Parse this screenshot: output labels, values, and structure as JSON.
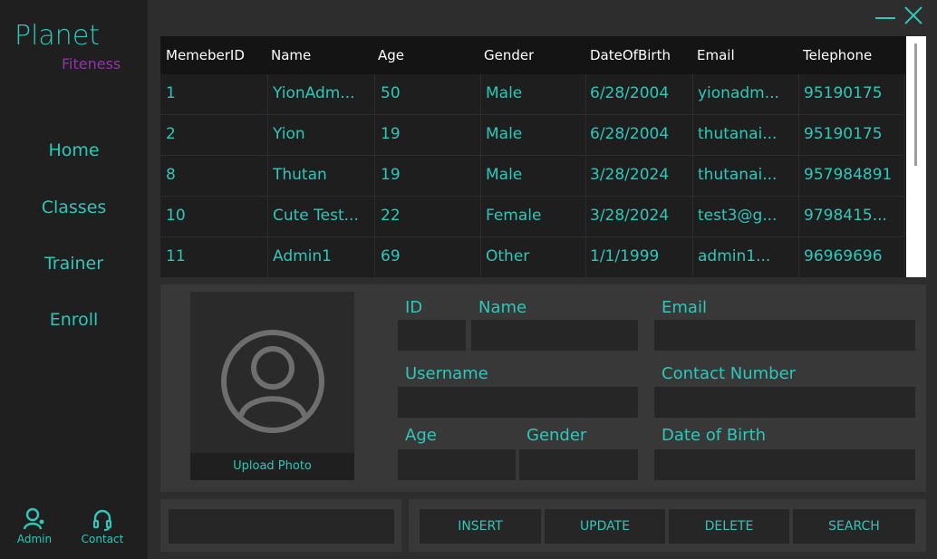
{
  "brand": {
    "title": "Planet",
    "subtitle": "Fiteness"
  },
  "nav": {
    "items": [
      {
        "label": "Home"
      },
      {
        "label": "Classes"
      },
      {
        "label": "Trainer"
      },
      {
        "label": "Enroll"
      }
    ],
    "bottom": [
      {
        "label": "Admin",
        "icon": "admin-user-icon"
      },
      {
        "label": "Contact",
        "icon": "headset-icon"
      }
    ]
  },
  "window": {
    "minimize_icon": "minimize-icon",
    "close_icon": "close-icon"
  },
  "table": {
    "columns": [
      "MemeberID",
      "Name",
      "Age",
      "Gender",
      "DateOfBirth",
      "Email",
      "Telephone"
    ],
    "rows": [
      [
        "1",
        "YionAdm...",
        "50",
        "Male",
        "6/28/2004",
        "yionadm...",
        "95190175"
      ],
      [
        "2",
        "Yion",
        "19",
        "Male",
        "6/28/2004",
        "thutanai...",
        "95190175"
      ],
      [
        "8",
        "Thutan",
        "19",
        "Male",
        "3/28/2024",
        "thutanai...",
        "957984891"
      ],
      [
        "10",
        "Cute Test...",
        "22",
        "Female",
        "3/28/2024",
        "test3@g...",
        "9798415..."
      ],
      [
        "11",
        "Admin1",
        "69",
        "Other",
        "1/1/1999",
        "admin1...",
        "96969696"
      ]
    ]
  },
  "form": {
    "upload_label": "Upload Photo",
    "labels": {
      "id": "ID",
      "name": "Name",
      "email": "Email",
      "username": "Username",
      "contact": "Contact Number",
      "age": "Age",
      "gender": "Gender",
      "dob": "Date of Birth"
    },
    "values": {
      "id": "",
      "name": "",
      "email": "",
      "username": "",
      "contact": "",
      "age": "",
      "gender": "",
      "dob": ""
    }
  },
  "actions": {
    "search_value": "",
    "insert": "INSERT",
    "update": "UPDATE",
    "delete": "DELETE",
    "search": "SEARCH"
  },
  "colors": {
    "accent": "#2fc7b9",
    "brand_sub": "#9a2fb3",
    "sidebar": "#1f1f1f",
    "panel": "#383838"
  }
}
